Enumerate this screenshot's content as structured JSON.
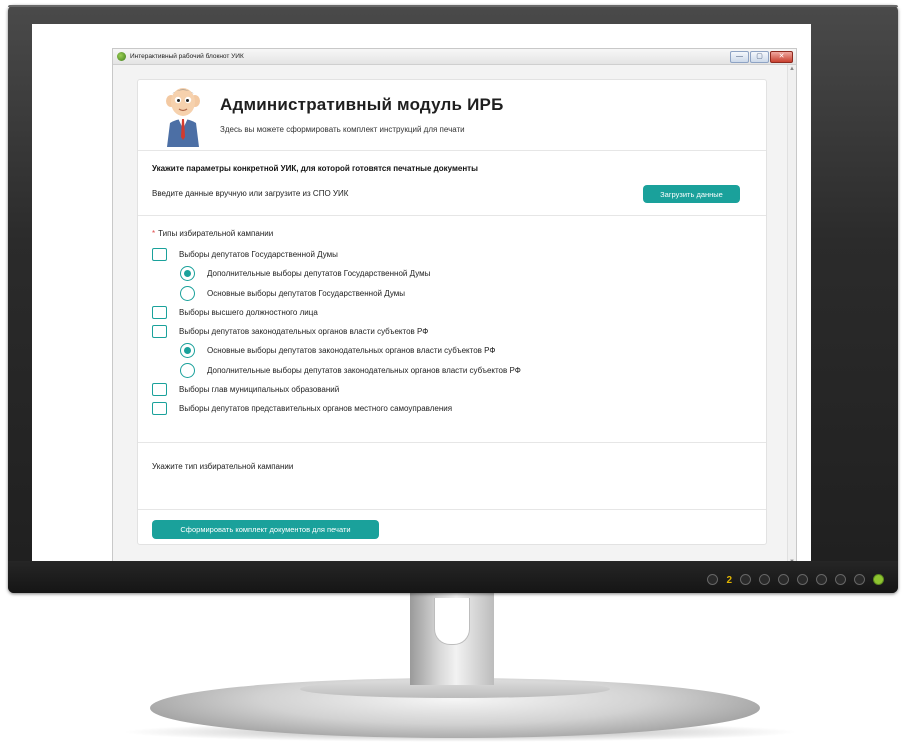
{
  "window": {
    "title": "Интерактивный рабочий блокнот УИК",
    "minimize_symbol": "—",
    "restore_symbol": "▢",
    "close_symbol": "✕"
  },
  "header": {
    "title": "Административный модуль ИРБ",
    "subtitle": "Здесь вы можете сформировать комплект инструкций для печати"
  },
  "params": {
    "title": "Укажите параметры конкретной УИК, для которой готовятся печатные документы",
    "hint": "Введите данные вручную или загрузите из СПО УИК",
    "load_button": "Загрузить данные"
  },
  "campaign_types": {
    "required_mark": "*",
    "label": "Типы избирательной кампании",
    "options": [
      {
        "kind": "checkbox",
        "label": "Выборы депутатов Государственной Думы",
        "checked": false
      },
      {
        "kind": "radio",
        "label": "Дополнительные выборы депутатов Государственной Думы",
        "checked": true
      },
      {
        "kind": "radio",
        "label": "Основные выборы депутатов Государственной Думы",
        "checked": false
      },
      {
        "kind": "checkbox",
        "label": "Выборы высшего должностного лица",
        "checked": false
      },
      {
        "kind": "checkbox",
        "label": "Выборы депутатов законодательных органов власти субъектов РФ",
        "checked": false
      },
      {
        "kind": "radio",
        "label": "Основные выборы депутатов законодательных органов власти субъектов РФ",
        "checked": true
      },
      {
        "kind": "radio",
        "label": "Дополнительные выборы депутатов законодательных органов власти субъектов РФ",
        "checked": false
      },
      {
        "kind": "checkbox",
        "label": "Выборы глав муниципальных образований",
        "checked": false
      },
      {
        "kind": "checkbox",
        "label": "Выборы депутатов представительных органов местного самоуправления",
        "checked": false
      }
    ]
  },
  "campaign_hint": "Укажите тип избирательной кампании",
  "footer": {
    "generate_button": "Сформировать комплект документов для печати"
  },
  "monitor": {
    "indicator_label": "2"
  },
  "colors": {
    "accent": "#1aa19b",
    "required": "#e04b4b"
  }
}
